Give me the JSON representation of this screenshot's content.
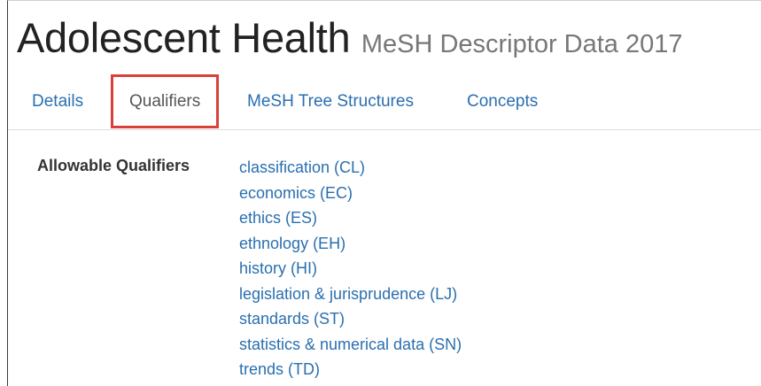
{
  "header": {
    "title": "Adolescent Health",
    "subtitle": "MeSH Descriptor Data 2017"
  },
  "tabs": [
    {
      "label": "Details",
      "active": false
    },
    {
      "label": "Qualifiers",
      "active": true
    },
    {
      "label": "MeSH Tree Structures",
      "active": false
    },
    {
      "label": "Concepts",
      "active": false
    }
  ],
  "qualifiers": {
    "label": "Allowable Qualifiers",
    "items": [
      "classification (CL)",
      "economics (EC)",
      "ethics (ES)",
      "ethnology (EH)",
      "history (HI)",
      "legislation & jurisprudence (LJ)",
      "standards (ST)",
      "statistics & numerical data (SN)",
      "trends (TD)"
    ]
  },
  "colors": {
    "link": "#2a6fb0",
    "highlight_box": "#d9403a"
  }
}
